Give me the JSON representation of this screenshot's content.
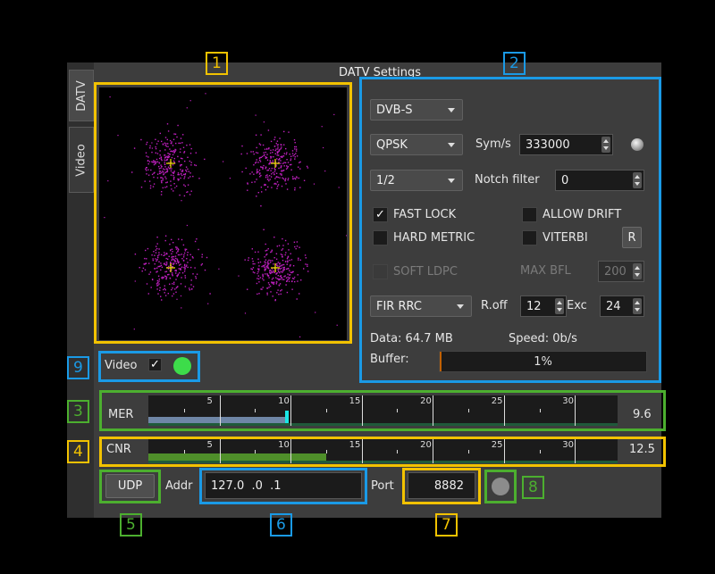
{
  "window": {
    "title": "DATV Settings"
  },
  "tabs": [
    {
      "label": "DATV"
    },
    {
      "label": "Video"
    }
  ],
  "callouts": [
    "1",
    "2",
    "3",
    "4",
    "5",
    "6",
    "7",
    "8",
    "9"
  ],
  "settings": {
    "standard": "DVB-S",
    "modulation": "QPSK",
    "symrate_label": "Sym/s",
    "symrate_value": "333000",
    "fec": "1/2",
    "notch_label": "Notch filter",
    "notch_value": "0",
    "fast_lock": {
      "label": "FAST LOCK",
      "checked": true,
      "mark": "✓"
    },
    "allow_drift": {
      "label": "ALLOW DRIFT",
      "checked": false
    },
    "hard_metric": {
      "label": "HARD METRIC",
      "checked": false
    },
    "viterbi": {
      "label": "VITERBI",
      "checked": false
    },
    "r_button": "R",
    "soft_ldpc": {
      "label": "SOFT LDPC",
      "checked": false,
      "enabled": false
    },
    "max_bfl_label": "MAX BFL",
    "max_bfl_value": "200",
    "filter": "FIR RRC",
    "roff_label": "R.off",
    "roff_value": "12",
    "exc_label": "Exc",
    "exc_value": "24",
    "data_text": "Data: 64.7 MB",
    "speed_text": "Speed: 0b/s",
    "buffer_label": "Buffer:",
    "buffer_text": "1%",
    "buffer_fraction": 0.01
  },
  "video": {
    "label": "Video",
    "checked": true,
    "mark": "✓",
    "status_color": "#3ddc4a"
  },
  "mer": {
    "label": "MER",
    "value_text": "9.6",
    "value": 9.6,
    "max": 33,
    "ticks": [
      "5",
      "10",
      "15",
      "20",
      "25",
      "30"
    ],
    "bar_color": "#6f86a6",
    "marker_color": "#19e6e6"
  },
  "cnr": {
    "label": "CNR",
    "value_text": "12.5",
    "value": 12.5,
    "max": 33,
    "ticks": [
      "5",
      "10",
      "15",
      "20",
      "25",
      "30"
    ],
    "bar_color": "#4f8f2a"
  },
  "udp": {
    "button": "UDP",
    "addr_label": "Addr",
    "addr_value": "127.0  .0  .1",
    "port_label": "Port",
    "port_value": "8882",
    "indicator_color": "#8c8c8c"
  },
  "colors": {
    "highlight_yellow": "#f2c200",
    "highlight_blue": "#1a9ae6",
    "highlight_green": "#4caf2f",
    "constellation_points": "#c020c0",
    "constellation_markers": "#f0e000"
  }
}
